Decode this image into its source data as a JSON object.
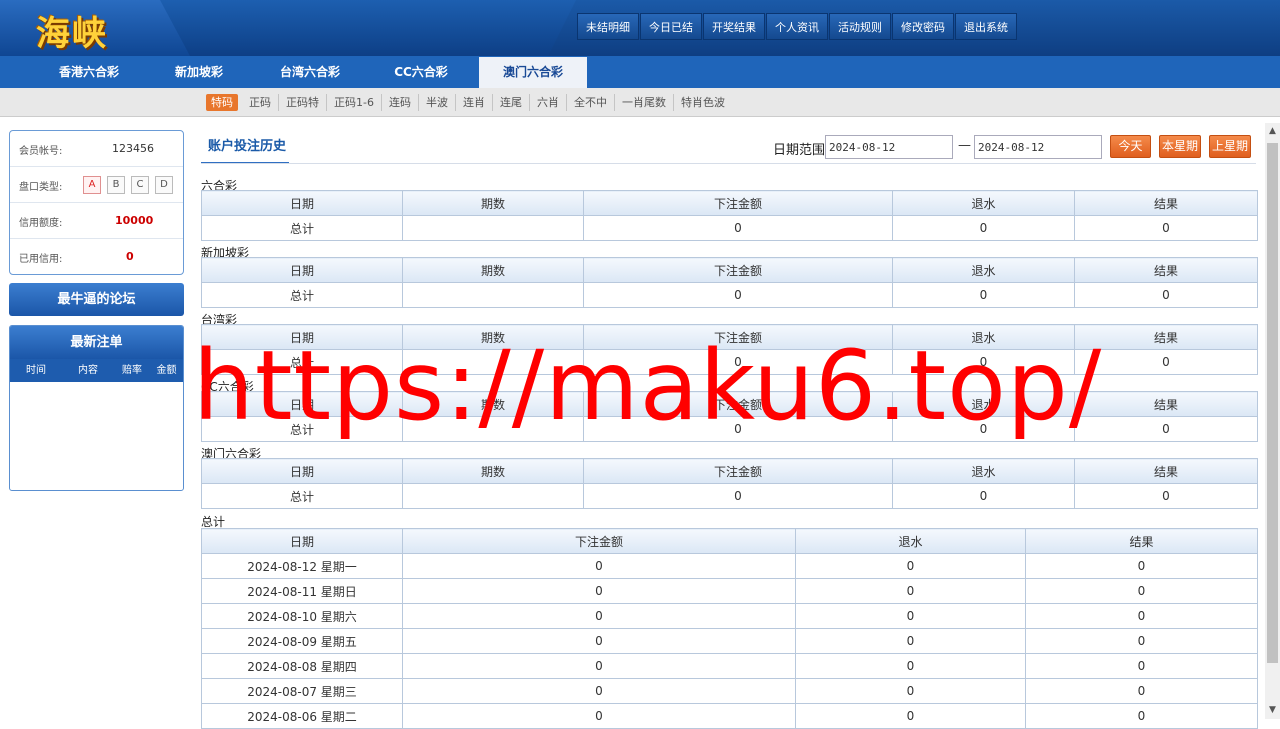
{
  "logo": "海峡",
  "topnav": [
    "未结明细",
    "今日已结",
    "开奖结果",
    "个人资讯",
    "活动规则",
    "修改密码",
    "退出系统"
  ],
  "tabs": [
    "香港六合彩",
    "新加坡彩",
    "台湾六合彩",
    "CC六合彩",
    "澳门六合彩"
  ],
  "active_tab": "澳门六合彩",
  "subtabs": [
    "特码",
    "正码",
    "正码特",
    "正码1-6",
    "连码",
    "半波",
    "连肖",
    "连尾",
    "六肖",
    "全不中",
    "一肖尾数",
    "特肖色波"
  ],
  "active_subtab": "特码",
  "account": {
    "member_label": "会员帐号:",
    "member_value": "123456",
    "plate_label": "盘口类型:",
    "plates": [
      "A",
      "B",
      "C",
      "D"
    ],
    "active_plate": "A",
    "credit_label": "信用额度:",
    "credit_value": "10000",
    "used_label": "已用信用:",
    "used_value": "0"
  },
  "forum_button": "最牛逼的论坛",
  "latest_orders": {
    "title": "最新注单",
    "columns": [
      "时间",
      "内容",
      "赔率",
      "金额"
    ]
  },
  "main": {
    "title": "账户投注历史",
    "date_range_label": "日期范围",
    "date_from": "2024-08-12",
    "date_to": "2024-08-12",
    "dash": "—",
    "buttons": [
      "今天",
      "本星期",
      "上星期"
    ]
  },
  "sections": [
    {
      "title": "六合彩",
      "headers": [
        "日期",
        "期数",
        "下注金额",
        "退水",
        "结果"
      ],
      "row": [
        "总计",
        "",
        "0",
        "0",
        "0"
      ]
    },
    {
      "title": "新加坡彩",
      "headers": [
        "日期",
        "期数",
        "下注金额",
        "退水",
        "结果"
      ],
      "row": [
        "总计",
        "",
        "0",
        "0",
        "0"
      ]
    },
    {
      "title": "台湾彩",
      "headers": [
        "日期",
        "期数",
        "下注金额",
        "退水",
        "结果"
      ],
      "row": [
        "总计",
        "",
        "0",
        "0",
        "0"
      ]
    },
    {
      "title": "CC六合彩",
      "headers": [
        "日期",
        "期数",
        "下注金额",
        "退水",
        "结果"
      ],
      "row": [
        "总计",
        "",
        "0",
        "0",
        "0"
      ]
    },
    {
      "title": "澳门六合彩",
      "headers": [
        "日期",
        "期数",
        "下注金额",
        "退水",
        "结果"
      ],
      "row": [
        "总计",
        "",
        "0",
        "0",
        "0"
      ]
    }
  ],
  "summary": {
    "title": "总计",
    "headers": [
      "日期",
      "下注金额",
      "退水",
      "结果"
    ],
    "rows": [
      [
        "2024-08-12 星期一",
        "0",
        "0",
        "0"
      ],
      [
        "2024-08-11 星期日",
        "0",
        "0",
        "0"
      ],
      [
        "2024-08-10 星期六",
        "0",
        "0",
        "0"
      ],
      [
        "2024-08-09 星期五",
        "0",
        "0",
        "0"
      ],
      [
        "2024-08-08 星期四",
        "0",
        "0",
        "0"
      ],
      [
        "2024-08-07 星期三",
        "0",
        "0",
        "0"
      ],
      [
        "2024-08-06 星期二",
        "0",
        "0",
        "0"
      ]
    ]
  },
  "watermark": "https://maku6.top/",
  "colors": {
    "header": "#0d3f86",
    "accent": "#e05f1f",
    "link": "#1a5aa8",
    "value_red": "#cc0000",
    "watermark": "#ff0000"
  }
}
